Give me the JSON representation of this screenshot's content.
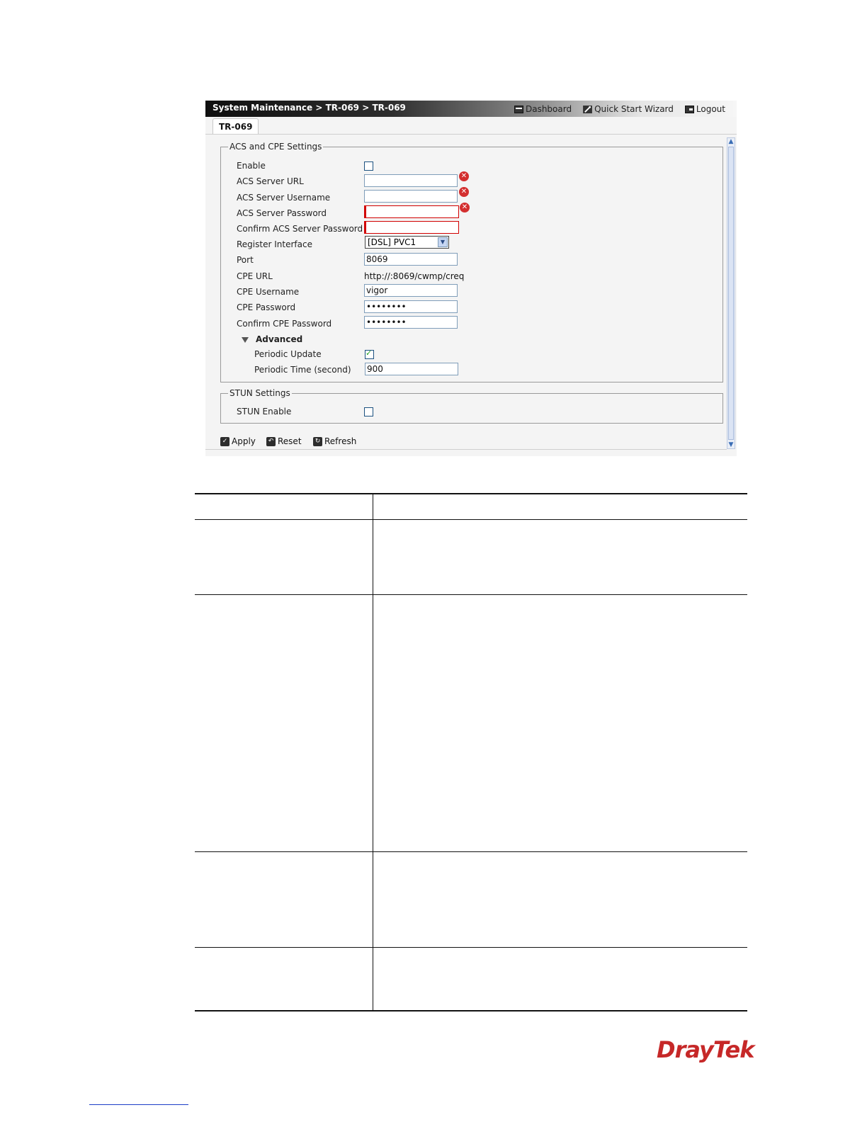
{
  "window": {
    "breadcrumb": "System Maintenance > TR-069 > TR-069",
    "links": {
      "dashboard": "Dashboard",
      "wizard": "Quick Start Wizard",
      "logout": "Logout"
    },
    "tab": "TR-069"
  },
  "acs": {
    "legend": "ACS and CPE Settings",
    "enable_label": "Enable",
    "enable_checked": false,
    "acs_url_label": "ACS Server URL",
    "acs_url_value": "",
    "acs_user_label": "ACS Server Username",
    "acs_user_value": "",
    "acs_pass_label": "ACS Server Password",
    "acs_pass_value": "",
    "acs_confirm_label": "Confirm ACS Server Password",
    "acs_confirm_value": "",
    "register_label": "Register Interface",
    "register_value": "[DSL] PVC1",
    "port_label": "Port",
    "port_value": "8069",
    "cpe_url_label": "CPE URL",
    "cpe_url_value": "http://:8069/cwmp/creq",
    "cpe_user_label": "CPE Username",
    "cpe_user_value": "vigor",
    "cpe_pass_label": "CPE Password",
    "cpe_pass_value": "••••••••",
    "cpe_confirm_label": "Confirm CPE Password",
    "cpe_confirm_value": "••••••••",
    "advanced_label": "Advanced",
    "periodic_update_label": "Periodic Update",
    "periodic_update_checked": true,
    "periodic_time_label": "Periodic Time (second)",
    "periodic_time_value": "900"
  },
  "stun": {
    "legend": "STUN Settings",
    "enable_label": "STUN Enable",
    "enable_checked": false
  },
  "buttons": {
    "apply": "Apply",
    "reset": "Reset",
    "refresh": "Refresh"
  },
  "brand": {
    "logo": "DrayTek",
    "color": "#c62828"
  },
  "colors": {
    "error": "#d10000",
    "accent": "#7f9db9"
  }
}
